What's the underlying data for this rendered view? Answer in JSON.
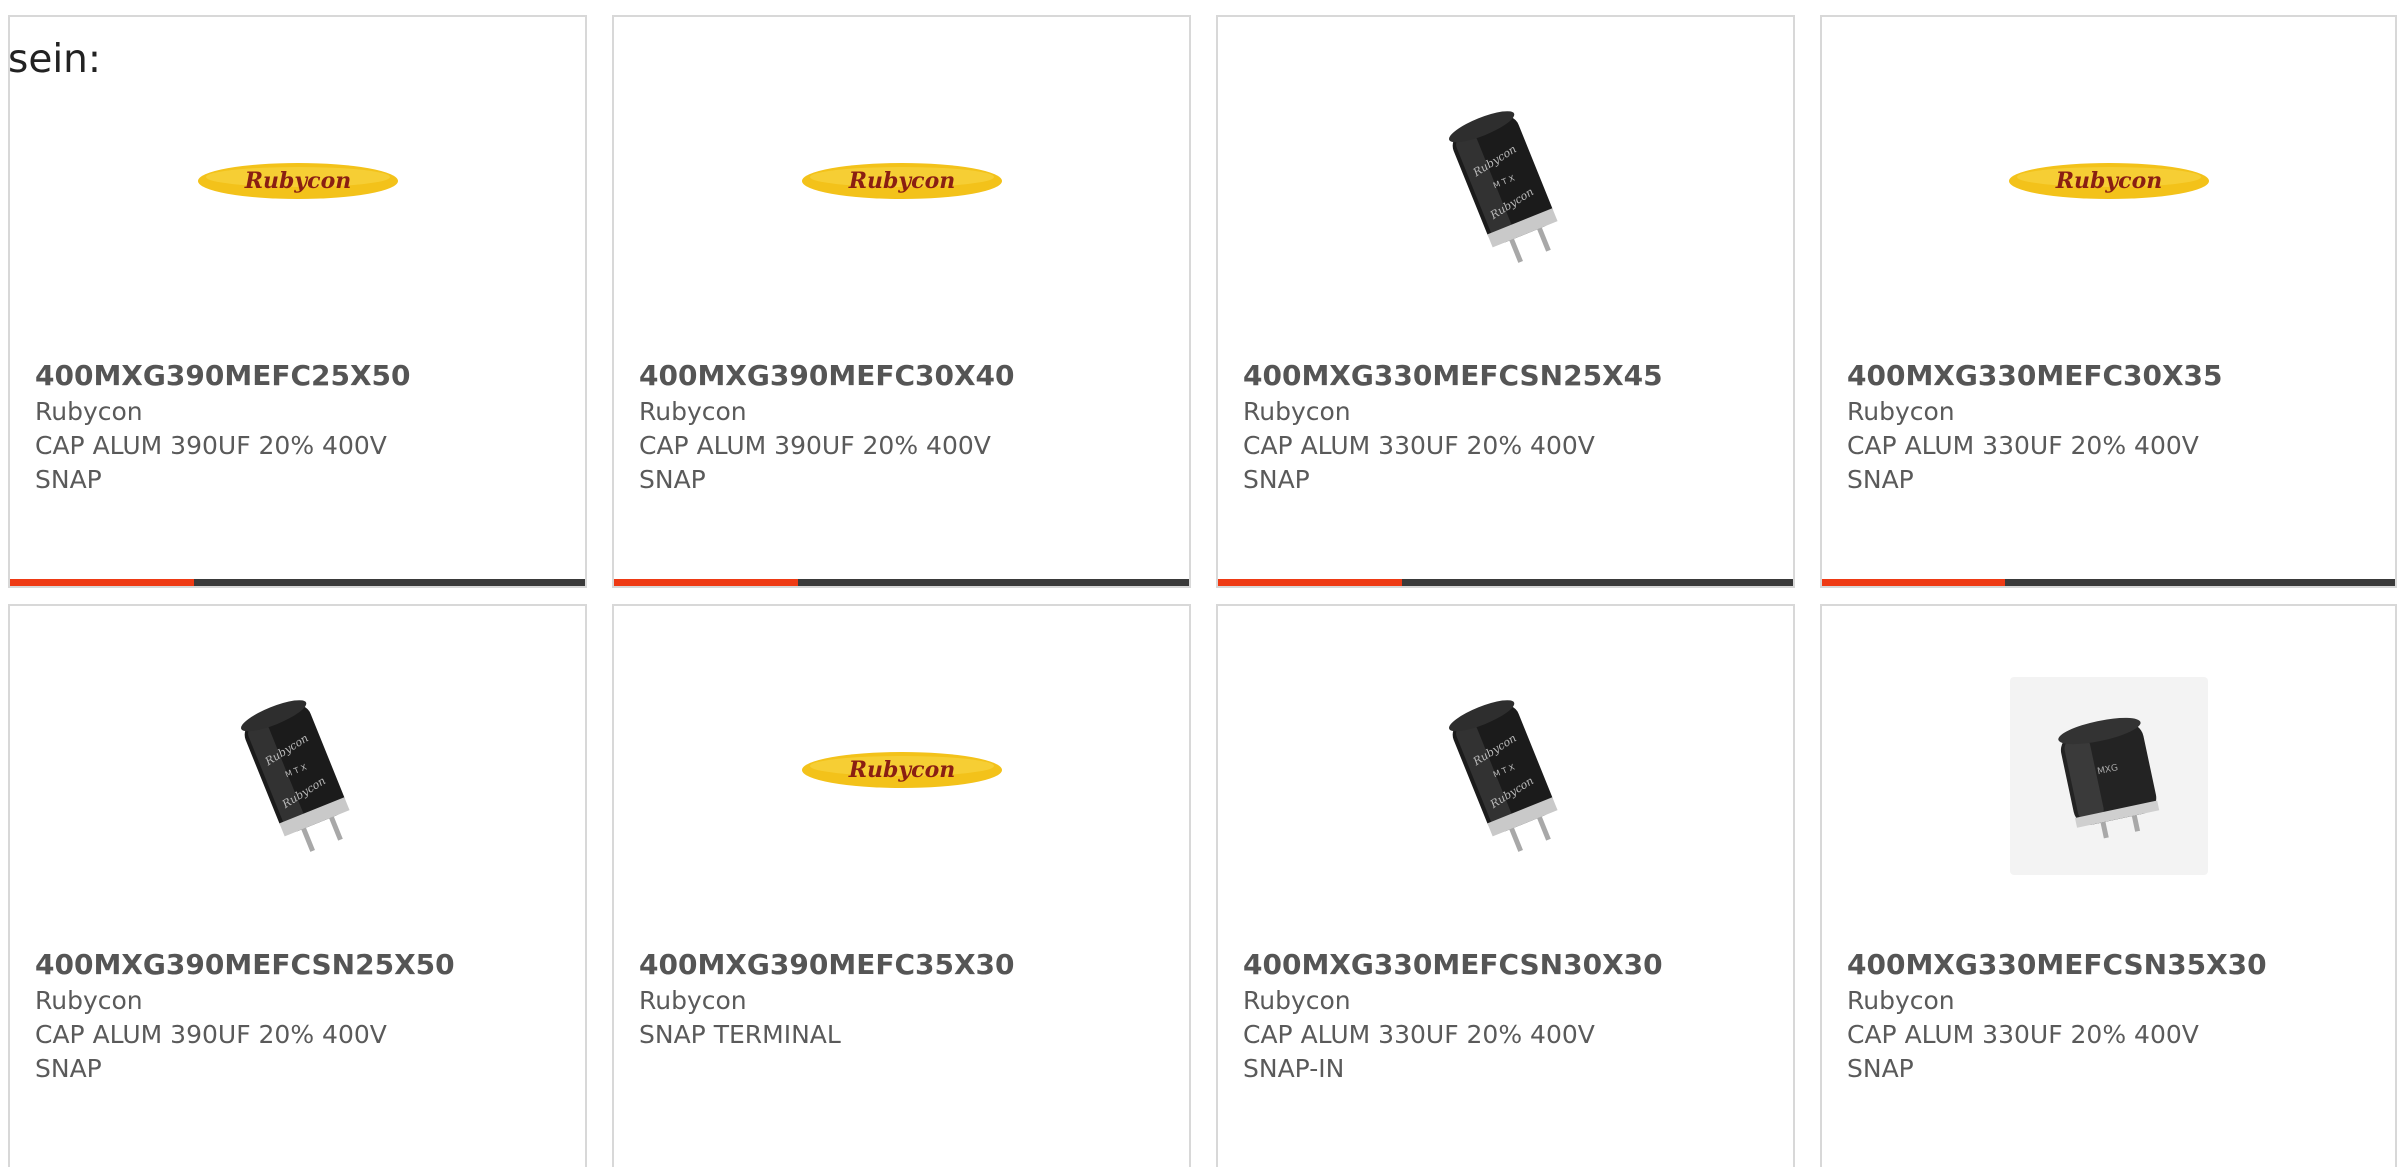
{
  "lead_text": "sein:",
  "cards": [
    {
      "part": "400MXG390MEFC25X50",
      "brand": "Rubycon",
      "desc": "CAP ALUM 390UF 20% 400V",
      "desc2": "SNAP",
      "image": "rubycon-logo",
      "progress": 0.32
    },
    {
      "part": "400MXG390MEFC30X40",
      "brand": "Rubycon",
      "desc": "CAP ALUM 390UF 20% 400V",
      "desc2": "SNAP",
      "image": "rubycon-logo",
      "progress": 0.32
    },
    {
      "part": "400MXG330MEFCSN25X45",
      "brand": "Rubycon",
      "desc": "CAP ALUM 330UF 20% 400V",
      "desc2": "SNAP",
      "image": "capacitor-tall",
      "progress": 0.32
    },
    {
      "part": "400MXG330MEFC30X35",
      "brand": "Rubycon",
      "desc": "CAP ALUM 330UF 20% 400V",
      "desc2": "SNAP",
      "image": "rubycon-logo",
      "progress": 0.32
    },
    {
      "part": "400MXG390MEFCSN25X50",
      "brand": "Rubycon",
      "desc": "CAP ALUM 390UF 20% 400V",
      "desc2": "SNAP",
      "image": "capacitor-tall"
    },
    {
      "part": "400MXG390MEFC35X30",
      "brand": "Rubycon",
      "desc": "SNAP TERMINAL",
      "desc2": "",
      "image": "rubycon-logo"
    },
    {
      "part": "400MXG330MEFCSN30X30",
      "brand": "Rubycon",
      "desc": "CAP ALUM 330UF 20% 400V",
      "desc2": "SNAP-IN",
      "image": "capacitor-tall"
    },
    {
      "part": "400MXG330MEFCSN35X30",
      "brand": "Rubycon",
      "desc": "CAP ALUM 330UF 20% 400V",
      "desc2": "SNAP",
      "image": "capacitor-short"
    }
  ],
  "logo_text": "Rubycon",
  "colors": {
    "accent": "#ee3a14",
    "bar": "#3a3a3a",
    "logo_yellow": "#f3c21a",
    "border": "#d8d8d8"
  }
}
